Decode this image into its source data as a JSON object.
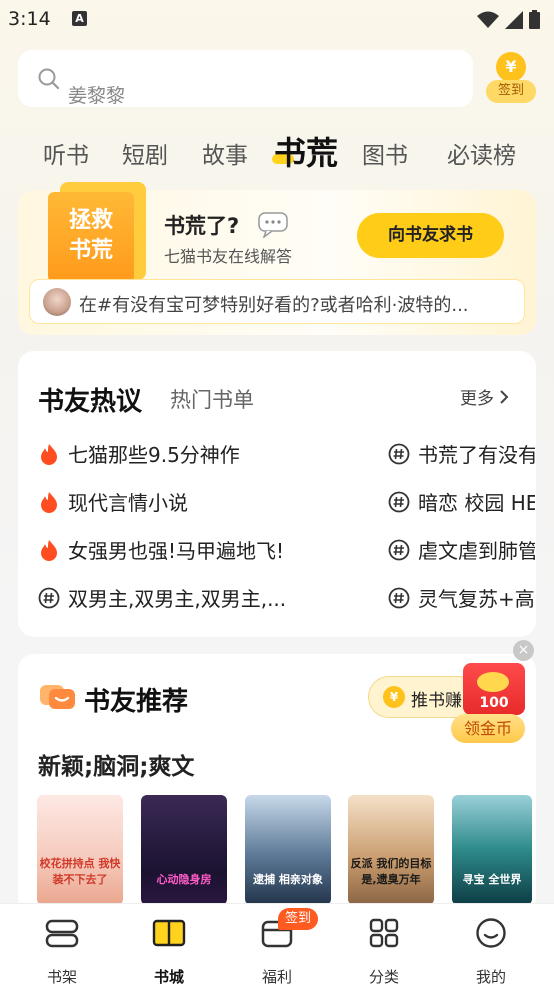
{
  "status_bar": {
    "time": "3:14",
    "notification_icon": "A"
  },
  "search": {
    "placeholder": "姜黎黎"
  },
  "signin": {
    "coin": "¥",
    "label": "签到"
  },
  "tabs": [
    {
      "label": "听书"
    },
    {
      "label": "短剧"
    },
    {
      "label": "故事"
    },
    {
      "label": "书荒"
    },
    {
      "label": "图书"
    },
    {
      "label": "必读榜"
    }
  ],
  "rescue": {
    "book_text_1": "拯救",
    "book_text_2": "书荒",
    "title": "书荒了?",
    "subtitle": "七猫书友在线解答",
    "ask_button": "向书友求书",
    "ticker": "在#有没有宝可梦特别好看的?或者哈利·波特的..."
  },
  "discuss": {
    "title": "书友热议",
    "subtitle": "热门书单",
    "more": "更多",
    "left_topics": [
      "七猫那些9.5分神作",
      "现代言情小说",
      "女强男也强!马甲遍地飞!",
      "双男主,双男主,双男主,..."
    ],
    "right_topics": [
      "书荒了有没有",
      "暗恋 校园 HE",
      "虐文虐到肺管",
      "灵气复苏+高"
    ]
  },
  "recommend": {
    "title": "书友推荐",
    "push_button": "推书赚",
    "red_packet": "100",
    "gold_button": "领金币",
    "genre": "新颖;脑洞;爽文",
    "covers": [
      {
        "title": "校花拼持点 我快装不下去了"
      },
      {
        "title": "心动隐身房"
      },
      {
        "title": "逮捕 相亲对象"
      },
      {
        "title": "反派 我们的目标是,遗臭万年"
      },
      {
        "title": "寻宝 全世界"
      }
    ]
  },
  "nav": {
    "items": [
      {
        "label": "书架"
      },
      {
        "label": "书城"
      },
      {
        "label": "福利"
      },
      {
        "label": "分类"
      },
      {
        "label": "我的"
      }
    ],
    "welfare_badge": "签到"
  }
}
